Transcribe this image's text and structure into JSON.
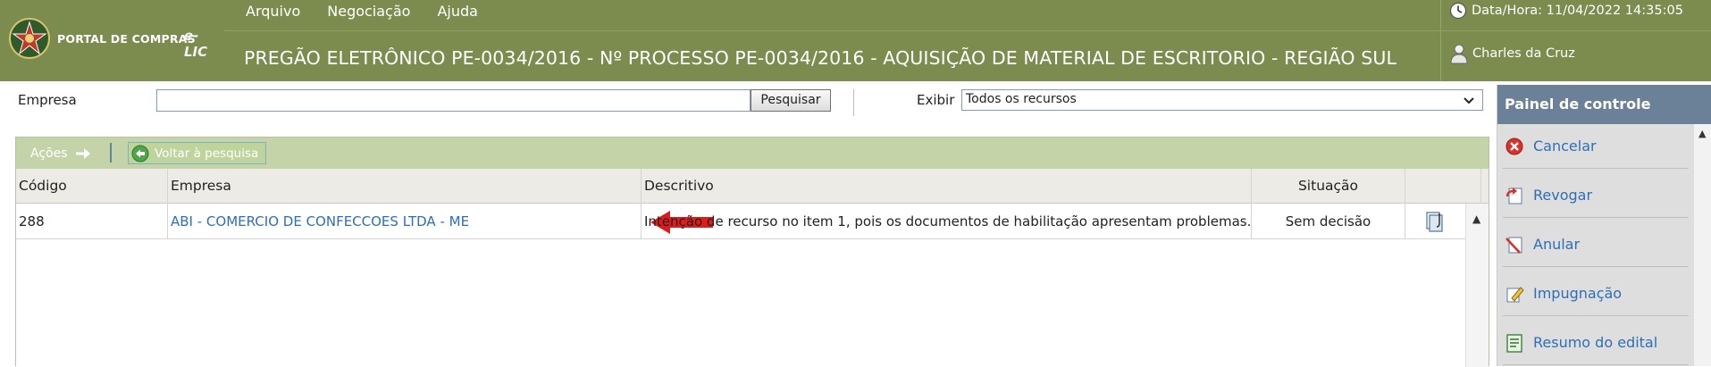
{
  "brand": {
    "portal": "PORTAL DE COMPRAS",
    "elic": "e-LIC"
  },
  "menu": [
    "Arquivo",
    "Negociação",
    "Ajuda"
  ],
  "header": {
    "datetime": "Data/Hora: 11/04/2022 14:35:05",
    "title": "PREGÃO ELETRÔNICO PE-0034/2016 - Nº PROCESSO PE-0034/2016 - AQUISIÇÃO DE MATERIAL DE ESCRITORIO - REGIÃO SUL",
    "user": "Charles da Cruz"
  },
  "search": {
    "empresa_label": "Empresa",
    "empresa_value": "",
    "button": "Pesquisar",
    "exibir_label": "Exibir",
    "exibir_value": "Todos os recursos"
  },
  "toolbar": {
    "acoes": "Ações",
    "voltar": "Voltar à pesquisa"
  },
  "table": {
    "headers": {
      "codigo": "Código",
      "empresa": "Empresa",
      "descritivo": "Descritivo",
      "situacao": "Situação"
    },
    "rows": [
      {
        "codigo": "288",
        "empresa": "ABI - COMERCIO DE CONFECCOES LTDA - ME",
        "descritivo": "Intenção de recurso no item 1, pois os documentos de habilitação apresentam problemas.",
        "situacao": "Sem decisão"
      }
    ]
  },
  "panel": {
    "title": "Painel de controle",
    "items": [
      "Cancelar",
      "Revogar",
      "Anular",
      "Impugnação",
      "Resumo do edital"
    ]
  },
  "colors": {
    "header_bg": "#7c8c4f",
    "panel_head": "#6a8198",
    "link": "#2e6eb8",
    "arrow": "#e01b1b"
  }
}
